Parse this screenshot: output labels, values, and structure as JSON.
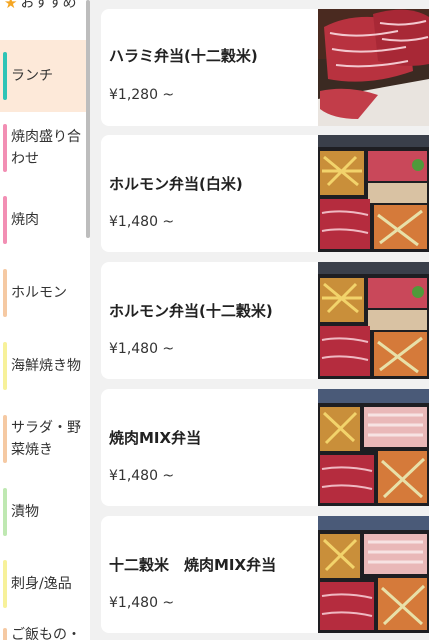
{
  "sidebar": {
    "items": [
      {
        "label": "おすすめ",
        "accent": "#f5a623"
      },
      {
        "label": "ランチ",
        "accent": "#2ec4b6"
      },
      {
        "label": "焼肉盛り合わせ",
        "accent": "#f28fb4"
      },
      {
        "label": "焼肉",
        "accent": "#f28fb4"
      },
      {
        "label": "ホルモン",
        "accent": "#f5c9a3"
      },
      {
        "label": "海鮮焼き物",
        "accent": "#f7f19a"
      },
      {
        "label": "サラダ・野菜焼き",
        "accent": "#f5c9a3"
      },
      {
        "label": "漬物",
        "accent": "#bfe8b2"
      },
      {
        "label": "刺身/逸品",
        "accent": "#f7f19a"
      },
      {
        "label": "ご飯もの・",
        "accent": "#f5c9a3"
      }
    ],
    "active_index": 1,
    "active_bg": "#fde9d9"
  },
  "products": [
    {
      "name": "ハラミ弁当(十二穀米)",
      "price": "¥1,280 ~",
      "image": "sliced-beef-photo"
    },
    {
      "name": "ホルモン弁当(白米)",
      "price": "¥1,480 ~",
      "image": "bento-box-photo"
    },
    {
      "name": "ホルモン弁当(十二穀米)",
      "price": "¥1,480 ~",
      "image": "bento-box-photo"
    },
    {
      "name": "焼肉MIX弁当",
      "price": "¥1,480 ~",
      "image": "bento-box-photo"
    },
    {
      "name": "十二穀米　焼肉MIX弁当",
      "price": "¥1,480 ~",
      "image": "bento-box-photo"
    }
  ]
}
